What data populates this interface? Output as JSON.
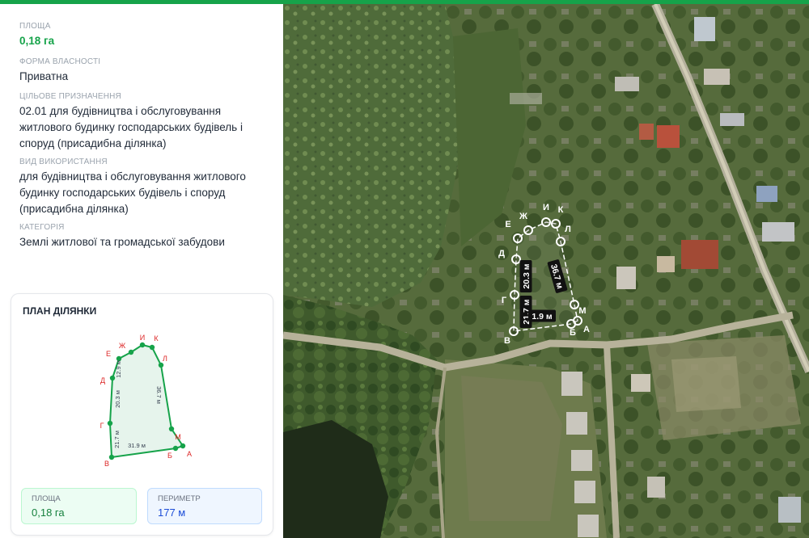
{
  "info": {
    "area_label": "Площа",
    "area_value": "0,18 га",
    "ownership_label": "Форма власності",
    "ownership_value": "Приватна",
    "purpose_label": "Цільове призначення",
    "purpose_value": "02.01 для будівництва і обслуговування житлового будинку господарських будівель і споруд (присадибна ділянка)",
    "usage_label": "Вид використання",
    "usage_value": "для будівництва і обслуговування житлового будинку господарських будівель і споруд (присадибна ділянка)",
    "category_label": "Категорія",
    "category_value": "Землі житлової та громадської забудови"
  },
  "plan": {
    "title": "План ділянки",
    "vertices": [
      "А",
      "Б",
      "В",
      "Г",
      "Д",
      "Е",
      "Ж",
      "И",
      "К",
      "Л",
      "М"
    ],
    "segments": [
      "12.9 м",
      "20.3 м",
      "21.7 м",
      "31.9 м",
      "36.7 м"
    ],
    "area_label": "Площа",
    "area_value": "0,18 га",
    "perimeter_label": "Периметр",
    "perimeter_value": "177 м"
  },
  "map": {
    "vertices": [
      "А",
      "Б",
      "В",
      "Г",
      "Д",
      "Е",
      "Ж",
      "И",
      "К",
      "Л",
      "М"
    ],
    "segments": [
      "20.3 м",
      "36.7 м",
      "21.7 м",
      "1.9 м"
    ]
  },
  "colors": {
    "accent": "#16a34a",
    "vertex_label": "#dc2626"
  }
}
